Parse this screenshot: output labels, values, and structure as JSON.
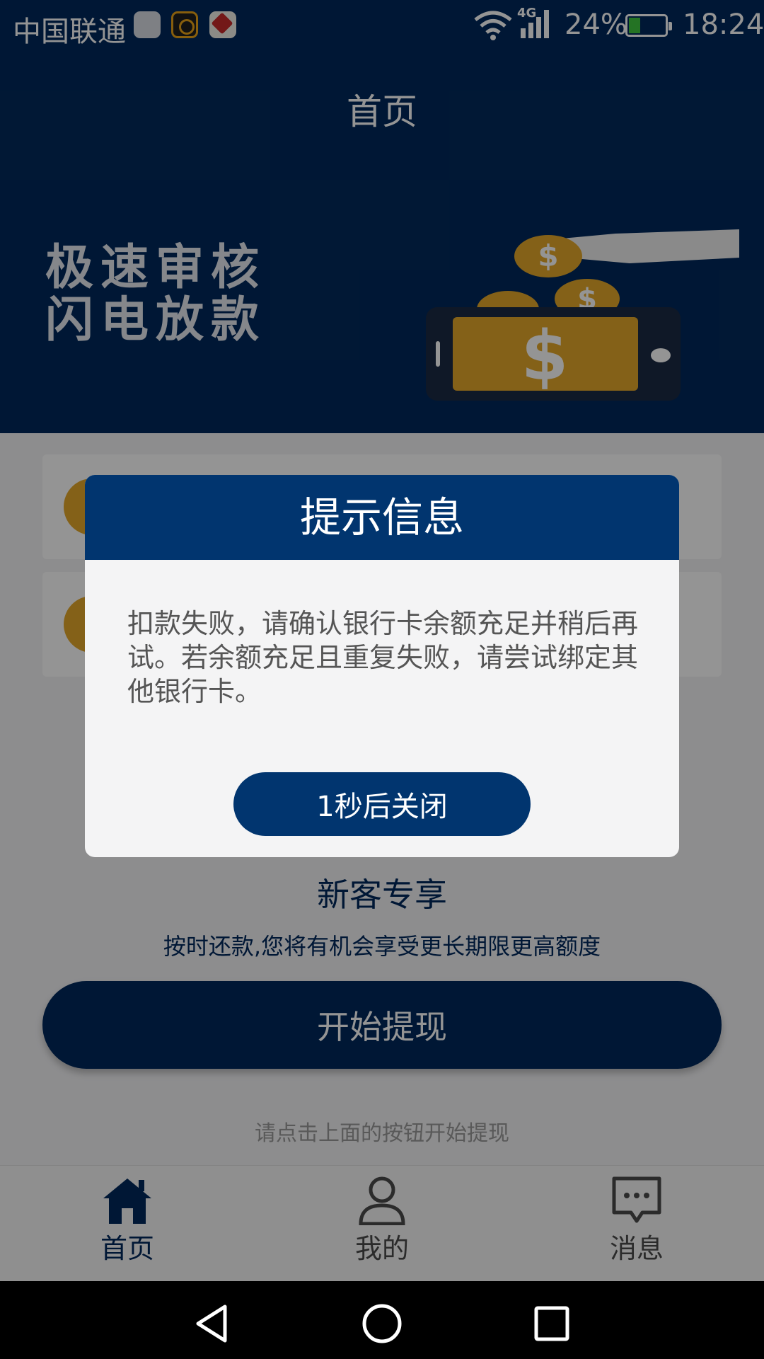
{
  "status_bar": {
    "carrier": "中国联通",
    "network": "4G",
    "battery": "24%",
    "time": "18:24"
  },
  "header": {
    "title": "首页"
  },
  "banner": {
    "line1": "极速审核",
    "line2": "闪电放款"
  },
  "promo": {
    "title": "新客专享",
    "description": "按时还款,您将有机会享受更长期限更高额度",
    "button": "开始提现",
    "hint": "请点击上面的按钮开始提现"
  },
  "bottom_nav": {
    "items": [
      {
        "label": "首页",
        "icon": "home-icon",
        "active": true
      },
      {
        "label": "我的",
        "icon": "user-icon",
        "active": false
      },
      {
        "label": "消息",
        "icon": "message-icon",
        "active": false
      }
    ]
  },
  "dialog": {
    "title": "提示信息",
    "message": "扣款失败，请确认银行卡余额充足并稍后再试。若余额充足且重复失败，请尝试绑定其他银行卡。",
    "close_button": "1秒后关闭"
  },
  "colors": {
    "primary": "#01295c",
    "dialog_primary": "#01356f",
    "coin": "#e4a72a"
  }
}
